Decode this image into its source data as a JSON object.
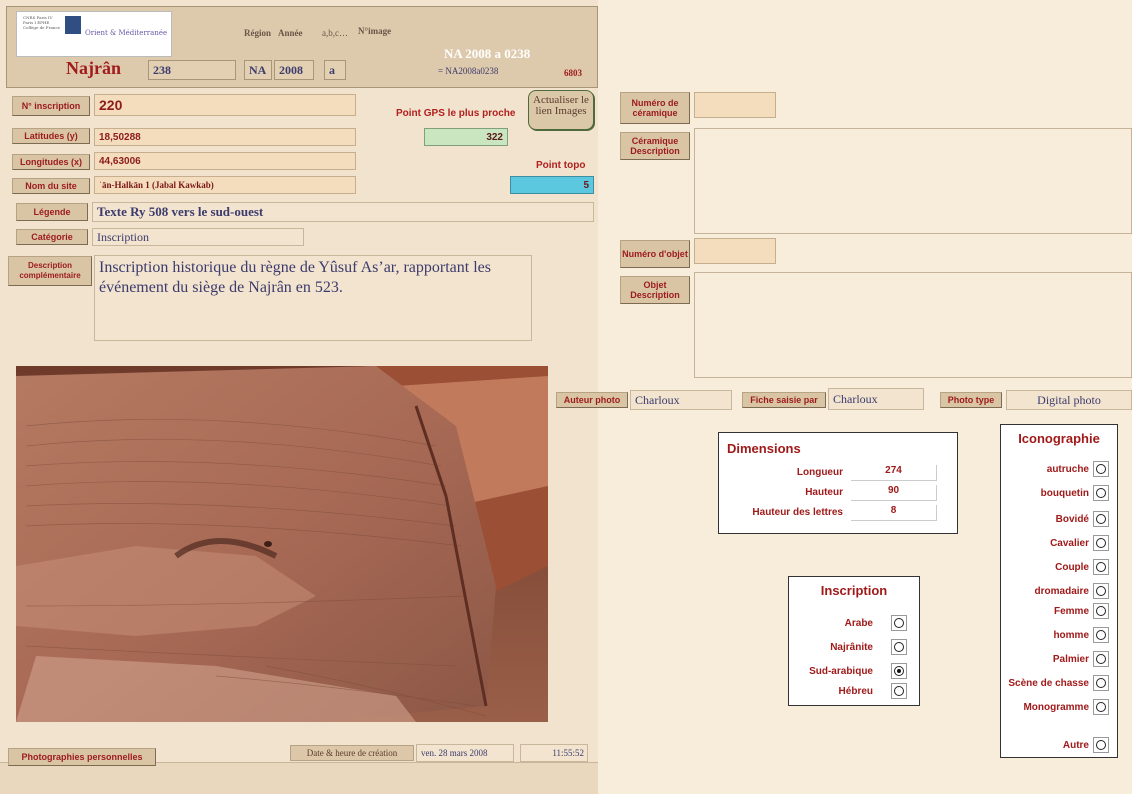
{
  "header": {
    "logo_text": "Orient & Méditerranée",
    "logo_small": "CNRS Paris IV Paris I EPHE Collège de France",
    "title": "Najrân",
    "region_label": "Région",
    "annee_label": "Année",
    "abc_label": "a,b,c…",
    "nimage_label": "N°image",
    "region_value": "238",
    "na_value": "NA",
    "annee_value": "2008",
    "abc_value": "a",
    "ref_big": "NA 2008 a 0238",
    "ref_small": "= NA2008a0238",
    "record_no": "6803"
  },
  "left": {
    "inscription_btn": "N° inscription",
    "inscription_val": "220",
    "lat_btn": "Latitudes (y)",
    "lat_val": "18,50288",
    "lon_btn": "Longitudes (x)",
    "lon_val": "44,63006",
    "site_btn": "Nom du site",
    "site_val": "ˈān-Halkān 1 (Jabal Kawkab)",
    "gps_label": "Point GPS le plus proche",
    "gps_val": "322",
    "topo_label": "Point topo",
    "topo_val": "5",
    "actualiser_btn": "Actualiser le lien Images",
    "legende_btn": "Légende",
    "legende_val": "Texte Ry 508 vers le sud-ouest",
    "categorie_btn": "Catégorie",
    "categorie_val": "Inscription",
    "desc_btn": "Description complémentaire",
    "desc_val": "Inscription historique du règne de Yûsuf As’ar, rapportant les événement du siège de Najrân en 523.",
    "photos_btn": "Photographies personnelles",
    "date_label": "Date & heure de création",
    "date_val": "ven. 28 mars 2008",
    "time_val": "11:55:52"
  },
  "right": {
    "ceramique_num_btn": "Numéro de céramique",
    "ceramique_num_val": "",
    "ceramique_desc_btn": "Céramique Description",
    "ceramique_desc_val": "",
    "objet_num_btn": "Numéro d'objet",
    "objet_num_val": "",
    "objet_desc_btn": "Objet Description",
    "objet_desc_val": ""
  },
  "meta": {
    "auteur_btn": "Auteur photo",
    "auteur_val": "Charloux",
    "fiche_btn": "Fiche saisie par",
    "fiche_val": "Charloux",
    "phototype_btn": "Photo type",
    "phototype_val": "Digital photo"
  },
  "dimensions": {
    "title": "Dimensions",
    "rows": [
      {
        "label": "Longueur",
        "value": "274"
      },
      {
        "label": "Hauteur",
        "value": "90"
      },
      {
        "label": "Hauteur des lettres",
        "value": "8"
      }
    ]
  },
  "inscription": {
    "title": "Inscription",
    "options": [
      {
        "label": "Arabe",
        "checked": false
      },
      {
        "label": "Najrânite",
        "checked": false
      },
      {
        "label": "Sud-arabique",
        "checked": true
      },
      {
        "label": "Hébreu",
        "checked": false
      }
    ]
  },
  "iconographie": {
    "title": "Iconographie",
    "options": [
      {
        "label": "autruche",
        "checked": false
      },
      {
        "label": "bouquetin",
        "checked": false
      },
      {
        "label": "Bovidé",
        "checked": false
      },
      {
        "label": "Cavalier",
        "checked": false
      },
      {
        "label": "Couple",
        "checked": false
      },
      {
        "label": "dromadaire",
        "checked": false
      },
      {
        "label": "Femme",
        "checked": false
      },
      {
        "label": "homme",
        "checked": false
      },
      {
        "label": "Palmier",
        "checked": false
      },
      {
        "label": "Scène de chasse",
        "checked": false
      },
      {
        "label": "Monogramme",
        "checked": false
      },
      {
        "label": "Autre",
        "checked": false
      }
    ]
  }
}
